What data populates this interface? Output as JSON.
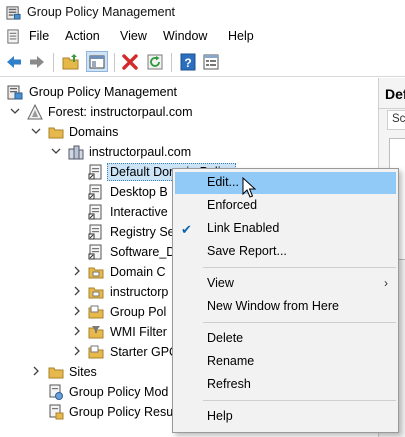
{
  "window": {
    "title": "Group Policy Management",
    "app_icon": "gpmc-icon"
  },
  "menubar": {
    "items": [
      "File",
      "Action",
      "View",
      "Window",
      "Help"
    ]
  },
  "toolbar": {
    "buttons": [
      "back-icon",
      "forward-icon",
      "up-folder-icon",
      "show-hide-tree-icon",
      "delete-icon",
      "refresh-icon",
      "help-icon",
      "properties-icon"
    ]
  },
  "tree": {
    "root": "Group Policy Management",
    "forest": "Forest: instructorpaul.com",
    "domains": "Domains",
    "domain": "instructorpaul.com",
    "children": [
      "Default Domain Policy",
      "Desktop B",
      "Interactive",
      "Registry Se",
      "Software_D",
      "Domain C",
      "instructorp",
      "Group Pol",
      "WMI Filter",
      "Starter GPO"
    ],
    "sites": "Sites",
    "modeling": "Group Policy Mod",
    "results": "Group Policy Resu"
  },
  "right_pane": {
    "title": "Def",
    "tab": "Sc"
  },
  "context_menu": {
    "items": [
      {
        "label": "Edit...",
        "highlighted": true
      },
      {
        "label": "Enforced"
      },
      {
        "label": "Link Enabled",
        "checked": true
      },
      {
        "label": "Save Report..."
      },
      {
        "label": "View",
        "submenu": true
      },
      {
        "label": "New Window from Here"
      },
      {
        "label": "Delete"
      },
      {
        "label": "Rename"
      },
      {
        "label": "Refresh"
      },
      {
        "label": "Help"
      }
    ]
  },
  "colors": {
    "highlight": "#91c9f7",
    "selection": "#cce4f7",
    "accent": "#0a64ad"
  }
}
